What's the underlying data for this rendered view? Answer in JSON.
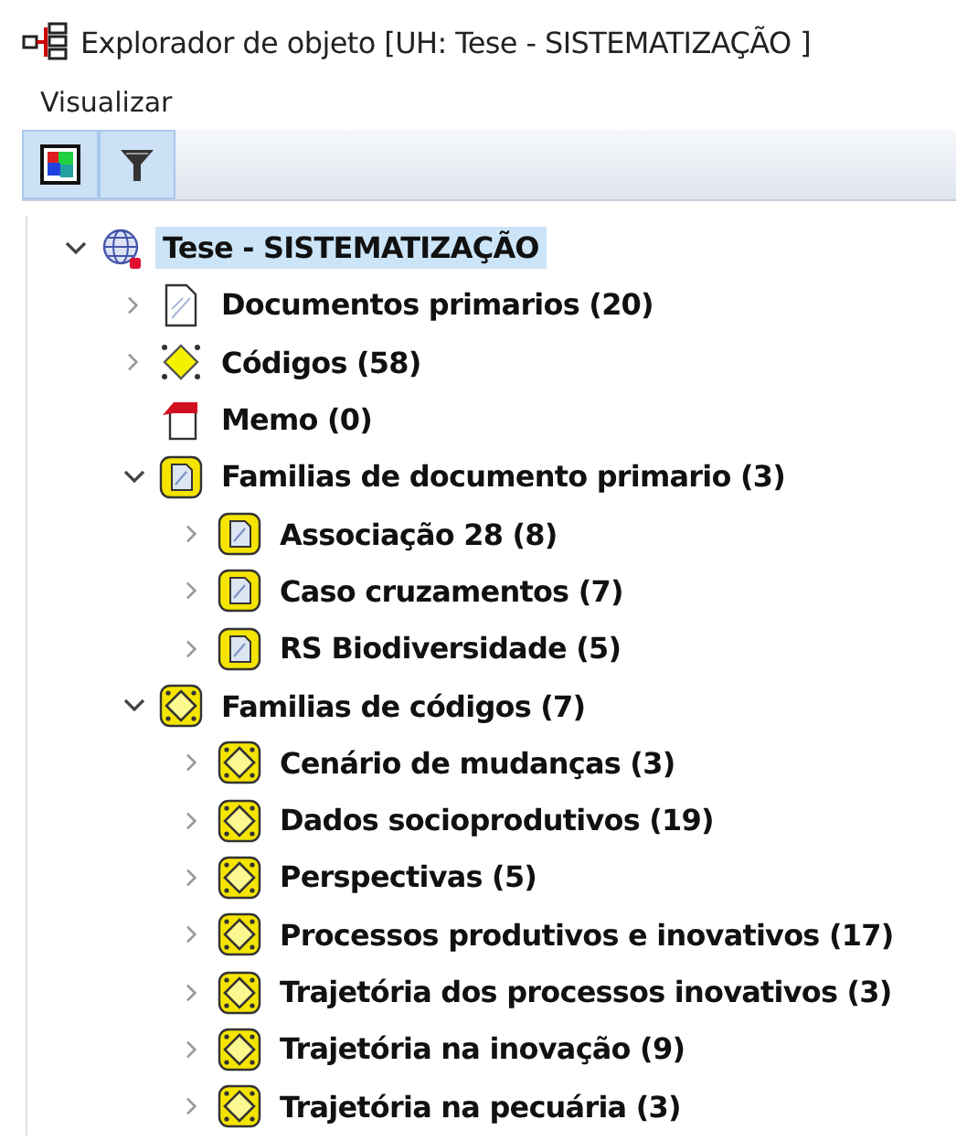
{
  "window": {
    "title": "Explorador de objeto [UH: Tese - SISTEMATIZAÇÃO ]"
  },
  "menu": [
    "Visualizar"
  ],
  "toolbar": [
    {
      "kind": "colors",
      "selected": true
    },
    {
      "kind": "filter",
      "selected": true
    }
  ],
  "tree": [
    {
      "label": "Tese - SISTEMATIZAÇÃO",
      "kind": "project",
      "selected": true,
      "expanded": true,
      "children": [
        {
          "label": "Documentos primarios (20)",
          "kind": "document",
          "selected": false,
          "expanded": false
        },
        {
          "label": "Códigos (58)",
          "kind": "codes",
          "selected": false,
          "expanded": false
        },
        {
          "label": "Memo (0)",
          "kind": "memo",
          "selected": false
        },
        {
          "label": "Familias de documento primario (3)",
          "kind": "docfamily",
          "selected": false,
          "expanded": true,
          "children": [
            {
              "label": "Associação 28 (8)",
              "kind": "docfamily",
              "selected": false,
              "expanded": false
            },
            {
              "label": "Caso cruzamentos (7)",
              "kind": "docfamily",
              "selected": false,
              "expanded": false
            },
            {
              "label": "RS Biodiversidade (5)",
              "kind": "docfamily",
              "selected": false,
              "expanded": false
            }
          ]
        },
        {
          "label": "Familias de códigos (7)",
          "kind": "codefamily",
          "selected": false,
          "expanded": true,
          "children": [
            {
              "label": "Cenário de mudanças (3)",
              "kind": "codefamily",
              "selected": false,
              "expanded": false
            },
            {
              "label": "Dados socioprodutivos (19)",
              "kind": "codefamily",
              "selected": false,
              "expanded": false
            },
            {
              "label": "Perspectivas (5)",
              "kind": "codefamily",
              "selected": false,
              "expanded": false
            },
            {
              "label": "Processos produtivos e inovativos (17)",
              "kind": "codefamily",
              "selected": false,
              "expanded": false
            },
            {
              "label": "Trajetória dos processos inovativos (3)",
              "kind": "codefamily",
              "selected": false,
              "expanded": false
            },
            {
              "label": "Trajetória na inovação (9)",
              "kind": "codefamily",
              "selected": false,
              "expanded": false
            },
            {
              "label": "Trajetória na pecuária (3)",
              "kind": "codefamily",
              "selected": false,
              "expanded": false
            }
          ]
        }
      ]
    }
  ]
}
